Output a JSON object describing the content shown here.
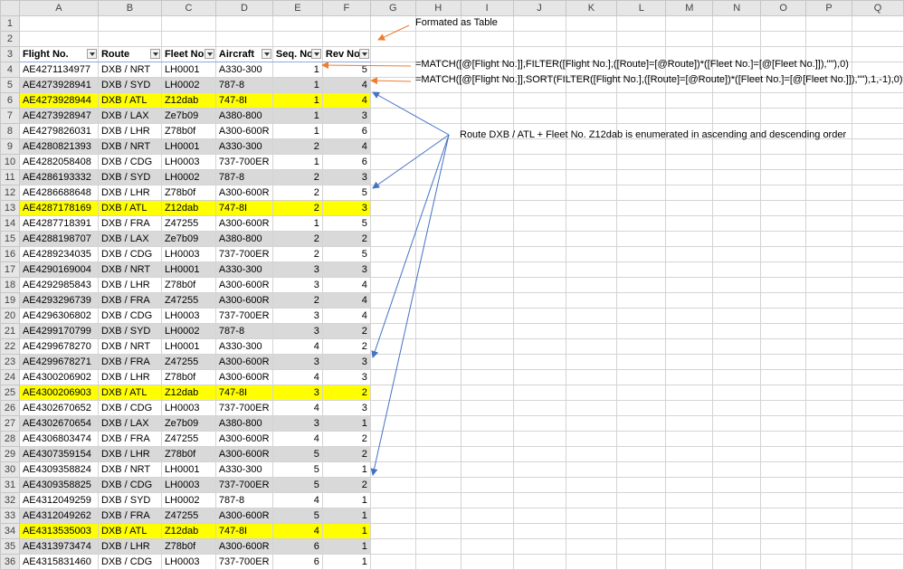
{
  "columns": [
    "",
    "A",
    "B",
    "C",
    "D",
    "E",
    "F",
    "G",
    "H",
    "I",
    "J",
    "K",
    "L",
    "M",
    "N",
    "O",
    "P",
    "Q"
  ],
  "table_headers": [
    "Flight No.",
    "Route",
    "Fleet No.",
    "Aircraft",
    "Seq. No",
    "Rev No."
  ],
  "rows": [
    [
      "AE4271134977",
      "DXB / NRT",
      "LH0001",
      "A330-300",
      "1",
      "5"
    ],
    [
      "AE4273928941",
      "DXB / SYD",
      "LH0002",
      "787-8",
      "1",
      "4"
    ],
    [
      "AE4273928944",
      "DXB / ATL",
      "Z12dab",
      "747-8I",
      "1",
      "4"
    ],
    [
      "AE4273928947",
      "DXB / LAX",
      "Ze7b09",
      "A380-800",
      "1",
      "3"
    ],
    [
      "AE4279826031",
      "DXB / LHR",
      "Z78b0f",
      "A300-600R",
      "1",
      "6"
    ],
    [
      "AE4280821393",
      "DXB / NRT",
      "LH0001",
      "A330-300",
      "2",
      "4"
    ],
    [
      "AE4282058408",
      "DXB / CDG",
      "LH0003",
      "737-700ER",
      "1",
      "6"
    ],
    [
      "AE4286193332",
      "DXB / SYD",
      "LH0002",
      "787-8",
      "2",
      "3"
    ],
    [
      "AE4286688648",
      "DXB / LHR",
      "Z78b0f",
      "A300-600R",
      "2",
      "5"
    ],
    [
      "AE4287178169",
      "DXB / ATL",
      "Z12dab",
      "747-8I",
      "2",
      "3"
    ],
    [
      "AE4287718391",
      "DXB / FRA",
      "Z47255",
      "A300-600R",
      "1",
      "5"
    ],
    [
      "AE4288198707",
      "DXB / LAX",
      "Ze7b09",
      "A380-800",
      "2",
      "2"
    ],
    [
      "AE4289234035",
      "DXB / CDG",
      "LH0003",
      "737-700ER",
      "2",
      "5"
    ],
    [
      "AE4290169004",
      "DXB / NRT",
      "LH0001",
      "A330-300",
      "3",
      "3"
    ],
    [
      "AE4292985843",
      "DXB / LHR",
      "Z78b0f",
      "A300-600R",
      "3",
      "4"
    ],
    [
      "AE4293296739",
      "DXB / FRA",
      "Z47255",
      "A300-600R",
      "2",
      "4"
    ],
    [
      "AE4296306802",
      "DXB / CDG",
      "LH0003",
      "737-700ER",
      "3",
      "4"
    ],
    [
      "AE4299170799",
      "DXB / SYD",
      "LH0002",
      "787-8",
      "3",
      "2"
    ],
    [
      "AE4299678270",
      "DXB / NRT",
      "LH0001",
      "A330-300",
      "4",
      "2"
    ],
    [
      "AE4299678271",
      "DXB / FRA",
      "Z47255",
      "A300-600R",
      "3",
      "3"
    ],
    [
      "AE4300206902",
      "DXB / LHR",
      "Z78b0f",
      "A300-600R",
      "4",
      "3"
    ],
    [
      "AE4300206903",
      "DXB / ATL",
      "Z12dab",
      "747-8I",
      "3",
      "2"
    ],
    [
      "AE4302670652",
      "DXB / CDG",
      "LH0003",
      "737-700ER",
      "4",
      "3"
    ],
    [
      "AE4302670654",
      "DXB / LAX",
      "Ze7b09",
      "A380-800",
      "3",
      "1"
    ],
    [
      "AE4306803474",
      "DXB / FRA",
      "Z47255",
      "A300-600R",
      "4",
      "2"
    ],
    [
      "AE4307359154",
      "DXB / LHR",
      "Z78b0f",
      "A300-600R",
      "5",
      "2"
    ],
    [
      "AE4309358824",
      "DXB / NRT",
      "LH0001",
      "A330-300",
      "5",
      "1"
    ],
    [
      "AE4309358825",
      "DXB / CDG",
      "LH0003",
      "737-700ER",
      "5",
      "2"
    ],
    [
      "AE4312049259",
      "DXB / SYD",
      "LH0002",
      "787-8",
      "4",
      "1"
    ],
    [
      "AE4312049262",
      "DXB / FRA",
      "Z47255",
      "A300-600R",
      "5",
      "1"
    ],
    [
      "AE4313535003",
      "DXB / ATL",
      "Z12dab",
      "747-8I",
      "4",
      "1"
    ],
    [
      "AE4313973474",
      "DXB / LHR",
      "Z78b0f",
      "A300-600R",
      "6",
      "1"
    ],
    [
      "AE4315831460",
      "DXB / CDG",
      "LH0003",
      "737-700ER",
      "6",
      "1"
    ]
  ],
  "highlighted_rows": [
    6,
    13,
    25,
    34
  ],
  "annotations": {
    "formatted_note": "Formated as Table",
    "formula1": "=MATCH([@[Flight No.]],FILTER([Flight No.],([Route]=[@Route])*([Fleet No.]=[@[Fleet No.]]),\"\"),0)",
    "formula2": "=MATCH([@[Flight No.]],SORT(FILTER([Flight No.],([Route]=[@Route])*([Fleet No.]=[@[Fleet No.]]),\"\"),1,-1),0)",
    "route_note": "Route DXB / ATL + Fleet No. Z12dab is enumerated in ascending and descending order"
  },
  "colors": {
    "highlight": "#ffff00",
    "band": "#d9d9d9",
    "arrow_orange": "#ed7d31",
    "arrow_blue": "#4472c4"
  }
}
